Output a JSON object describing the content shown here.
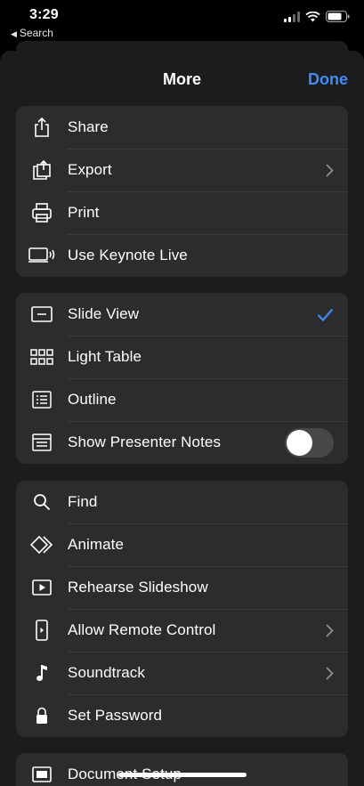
{
  "status_bar": {
    "time": "3:29",
    "back_label": "Search"
  },
  "header": {
    "title": "More",
    "done_label": "Done"
  },
  "groups": [
    {
      "items": [
        {
          "label": "Share",
          "icon": "share-icon"
        },
        {
          "label": "Export",
          "icon": "export-icon",
          "accessory": "chevron"
        },
        {
          "label": "Print",
          "icon": "print-icon"
        },
        {
          "label": "Use Keynote Live",
          "icon": "keynote-live-icon"
        }
      ]
    },
    {
      "items": [
        {
          "label": "Slide View",
          "icon": "slide-view-icon",
          "selected": true
        },
        {
          "label": "Light Table",
          "icon": "light-table-icon"
        },
        {
          "label": "Outline",
          "icon": "outline-icon"
        },
        {
          "label": "Show Presenter Notes",
          "icon": "presenter-notes-icon",
          "toggle": false
        }
      ]
    },
    {
      "items": [
        {
          "label": "Find",
          "icon": "search-icon"
        },
        {
          "label": "Animate",
          "icon": "animate-icon"
        },
        {
          "label": "Rehearse Slideshow",
          "icon": "rehearse-icon"
        },
        {
          "label": "Allow Remote Control",
          "icon": "remote-control-icon",
          "accessory": "chevron"
        },
        {
          "label": "Soundtrack",
          "icon": "music-note-icon",
          "accessory": "chevron"
        },
        {
          "label": "Set Password",
          "icon": "lock-icon"
        }
      ]
    },
    {
      "items": [
        {
          "label": "Document Setup",
          "icon": "document-setup-icon"
        }
      ]
    }
  ],
  "colors": {
    "accent": "#3d8df5",
    "sheet_bg": "#1c1c1e",
    "group_bg": "#2c2c2e",
    "toggle_off": "#48484a"
  }
}
